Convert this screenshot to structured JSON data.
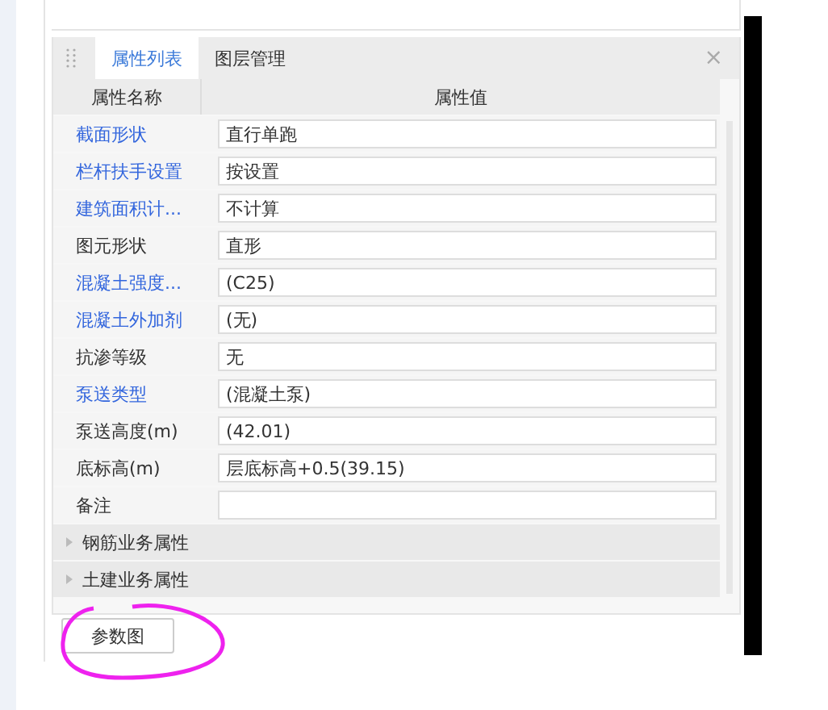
{
  "tabs": [
    {
      "label": "属性列表",
      "selected": true
    },
    {
      "label": "图层管理",
      "selected": false
    }
  ],
  "close": "×",
  "columns": [
    "属性名称",
    "属性值"
  ],
  "rows": [
    {
      "name": "截面形状",
      "value": "直行单跑",
      "link": true
    },
    {
      "name": "栏杆扶手设置",
      "value": "按设置",
      "link": true
    },
    {
      "name": "建筑面积计...",
      "value": "不计算",
      "link": true
    },
    {
      "name": "图元形状",
      "value": "直形",
      "link": false
    },
    {
      "name": "混凝土强度...",
      "value": "(C25)",
      "link": true
    },
    {
      "name": "混凝土外加剂",
      "value": "(无)",
      "link": true
    },
    {
      "name": "抗渗等级",
      "value": "无",
      "link": false
    },
    {
      "name": "泵送类型",
      "value": "(混凝土泵)",
      "link": true
    },
    {
      "name": "泵送高度(m)",
      "value": "(42.01)",
      "link": false
    },
    {
      "name": "底标高(m)",
      "value": "层底标高+0.5(39.15)",
      "link": false
    },
    {
      "name": "备注",
      "value": "",
      "link": false
    }
  ],
  "groups": [
    {
      "label": "钢筋业务属性",
      "expanded": false
    },
    {
      "label": "土建业务属性",
      "expanded": false
    }
  ],
  "button": "参数图"
}
